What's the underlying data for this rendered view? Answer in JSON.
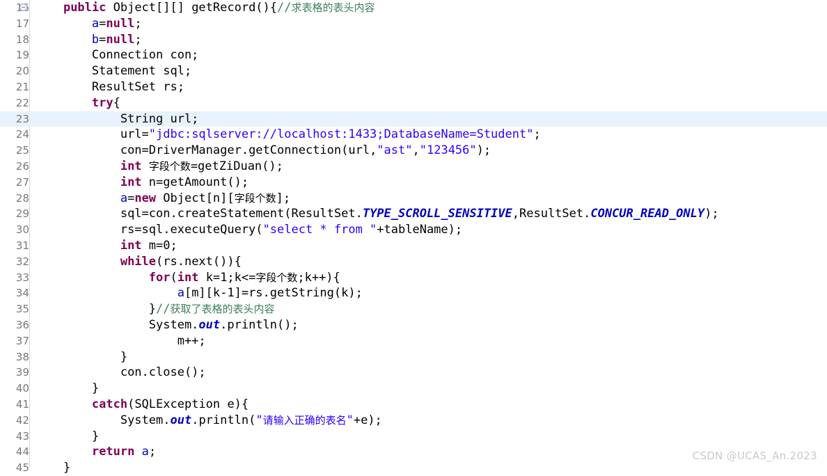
{
  "editor": {
    "first_line": 16,
    "current_line": 23,
    "folding_marker_line": 16,
    "colors": {
      "background": "#ffffff",
      "current_line_highlight": "#e8f2fc",
      "gutter_text": "#787878",
      "gutter_separator": "#d8d8d8",
      "keyword": "#7f0055",
      "string": "#2a00ff",
      "comment": "#3f7f5f",
      "field": "#0000c0",
      "static_constant": "#0000c0",
      "plain_text": "#000000",
      "watermark": "#c9c9c9"
    }
  },
  "watermark": "CSDN @UCAS_An.2023",
  "lines": [
    {
      "number": "16",
      "fold": true,
      "indent": 4,
      "tokens": [
        {
          "t": "public",
          "c": "kw"
        },
        {
          "t": " Object[][] getRecord(){",
          "c": "pln"
        },
        {
          "t": "//",
          "c": "cmt"
        },
        {
          "t": "求表格的表头内容",
          "c": "cmt cjk"
        }
      ]
    },
    {
      "number": "17",
      "fold": false,
      "indent": 8,
      "tokens": [
        {
          "t": "a",
          "c": "fld"
        },
        {
          "t": "=",
          "c": "pln"
        },
        {
          "t": "null",
          "c": "kw"
        },
        {
          "t": ";",
          "c": "pln"
        }
      ]
    },
    {
      "number": "18",
      "fold": false,
      "indent": 8,
      "tokens": [
        {
          "t": "b",
          "c": "fld"
        },
        {
          "t": "=",
          "c": "pln"
        },
        {
          "t": "null",
          "c": "kw"
        },
        {
          "t": ";",
          "c": "pln"
        }
      ]
    },
    {
      "number": "19",
      "fold": false,
      "indent": 8,
      "tokens": [
        {
          "t": "Connection con;",
          "c": "pln"
        }
      ]
    },
    {
      "number": "20",
      "fold": false,
      "indent": 8,
      "tokens": [
        {
          "t": "Statement sql;",
          "c": "pln"
        }
      ]
    },
    {
      "number": "21",
      "fold": false,
      "indent": 8,
      "tokens": [
        {
          "t": "ResultSet rs;",
          "c": "pln"
        }
      ]
    },
    {
      "number": "22",
      "fold": false,
      "indent": 8,
      "tokens": [
        {
          "t": "try",
          "c": "kw"
        },
        {
          "t": "{",
          "c": "pln"
        }
      ]
    },
    {
      "number": "23",
      "fold": false,
      "indent": 12,
      "tokens": [
        {
          "t": "String url;",
          "c": "pln"
        }
      ]
    },
    {
      "number": "24",
      "fold": false,
      "indent": 12,
      "tokens": [
        {
          "t": "url=",
          "c": "pln"
        },
        {
          "t": "\"jdbc:sqlserver://localhost:1433;DatabaseName=Student\"",
          "c": "str"
        },
        {
          "t": ";",
          "c": "pln"
        }
      ]
    },
    {
      "number": "25",
      "fold": false,
      "indent": 12,
      "tokens": [
        {
          "t": "con=DriverManager.",
          "c": "pln"
        },
        {
          "t": "getConnection",
          "c": "sm"
        },
        {
          "t": "(url,",
          "c": "pln"
        },
        {
          "t": "\"ast\"",
          "c": "str"
        },
        {
          "t": ",",
          "c": "pln"
        },
        {
          "t": "\"123456\"",
          "c": "str"
        },
        {
          "t": ");",
          "c": "pln"
        }
      ]
    },
    {
      "number": "26",
      "fold": false,
      "indent": 12,
      "tokens": [
        {
          "t": "int",
          "c": "kw"
        },
        {
          "t": " ",
          "c": "pln"
        },
        {
          "t": "字段个数",
          "c": "pln cjk"
        },
        {
          "t": "=getZiDuan();",
          "c": "pln"
        }
      ]
    },
    {
      "number": "27",
      "fold": false,
      "indent": 12,
      "tokens": [
        {
          "t": "int",
          "c": "kw"
        },
        {
          "t": " n=getAmount();",
          "c": "pln"
        }
      ]
    },
    {
      "number": "28",
      "fold": false,
      "indent": 12,
      "tokens": [
        {
          "t": "a",
          "c": "fld"
        },
        {
          "t": "=",
          "c": "pln"
        },
        {
          "t": "new",
          "c": "kw"
        },
        {
          "t": " Object[n][",
          "c": "pln"
        },
        {
          "t": "字段个数",
          "c": "pln cjk"
        },
        {
          "t": "];",
          "c": "pln"
        }
      ]
    },
    {
      "number": "29",
      "fold": false,
      "indent": 12,
      "tokens": [
        {
          "t": "sql=con.createStatement(ResultSet.",
          "c": "pln"
        },
        {
          "t": "TYPE_SCROLL_SENSITIVE",
          "c": "cst"
        },
        {
          "t": ",ResultSet.",
          "c": "pln"
        },
        {
          "t": "CONCUR_READ_ONLY",
          "c": "cst"
        },
        {
          "t": ");",
          "c": "pln"
        }
      ]
    },
    {
      "number": "30",
      "fold": false,
      "indent": 12,
      "tokens": [
        {
          "t": "rs=sql.executeQuery(",
          "c": "pln"
        },
        {
          "t": "\"select * from \"",
          "c": "str"
        },
        {
          "t": "+tableName);",
          "c": "pln"
        }
      ]
    },
    {
      "number": "31",
      "fold": false,
      "indent": 12,
      "tokens": [
        {
          "t": "int",
          "c": "kw"
        },
        {
          "t": " m=0;",
          "c": "pln"
        }
      ]
    },
    {
      "number": "32",
      "fold": false,
      "indent": 12,
      "tokens": [
        {
          "t": "while",
          "c": "kw"
        },
        {
          "t": "(rs.next()){",
          "c": "pln"
        }
      ]
    },
    {
      "number": "33",
      "fold": false,
      "indent": 16,
      "tokens": [
        {
          "t": "for",
          "c": "kw"
        },
        {
          "t": "(",
          "c": "pln"
        },
        {
          "t": "int",
          "c": "kw"
        },
        {
          "t": " k=1;k<=",
          "c": "pln"
        },
        {
          "t": "字段个数",
          "c": "pln cjk"
        },
        {
          "t": ";k++){",
          "c": "pln"
        }
      ]
    },
    {
      "number": "34",
      "fold": false,
      "indent": 20,
      "tokens": [
        {
          "t": "a",
          "c": "fld"
        },
        {
          "t": "[m][k-1]=rs.getString(k);",
          "c": "pln"
        }
      ]
    },
    {
      "number": "35",
      "fold": false,
      "indent": 16,
      "tokens": [
        {
          "t": "}",
          "c": "pln"
        },
        {
          "t": "//",
          "c": "cmt"
        },
        {
          "t": "获取了表格的表头内容",
          "c": "cmt cjk"
        }
      ]
    },
    {
      "number": "36",
      "fold": false,
      "indent": 16,
      "tokens": [
        {
          "t": "System.",
          "c": "pln"
        },
        {
          "t": "out",
          "c": "sfld"
        },
        {
          "t": ".println();",
          "c": "pln"
        }
      ]
    },
    {
      "number": "37",
      "fold": false,
      "indent": 20,
      "tokens": [
        {
          "t": "m++;",
          "c": "pln"
        }
      ]
    },
    {
      "number": "38",
      "fold": false,
      "indent": 12,
      "tokens": [
        {
          "t": "}",
          "c": "pln"
        }
      ]
    },
    {
      "number": "39",
      "fold": false,
      "indent": 12,
      "tokens": [
        {
          "t": "con.close();",
          "c": "pln"
        }
      ]
    },
    {
      "number": "40",
      "fold": false,
      "indent": 8,
      "tokens": [
        {
          "t": "}",
          "c": "pln"
        }
      ]
    },
    {
      "number": "41",
      "fold": false,
      "indent": 8,
      "tokens": [
        {
          "t": "catch",
          "c": "kw"
        },
        {
          "t": "(SQLException e){",
          "c": "pln"
        }
      ]
    },
    {
      "number": "42",
      "fold": false,
      "indent": 12,
      "tokens": [
        {
          "t": "System.",
          "c": "pln"
        },
        {
          "t": "out",
          "c": "sfld"
        },
        {
          "t": ".println(",
          "c": "pln"
        },
        {
          "t": "\"",
          "c": "str"
        },
        {
          "t": "请输入正确的表名",
          "c": "str cjk"
        },
        {
          "t": "\"",
          "c": "str"
        },
        {
          "t": "+e);",
          "c": "pln"
        }
      ]
    },
    {
      "number": "43",
      "fold": false,
      "indent": 8,
      "tokens": [
        {
          "t": "}",
          "c": "pln"
        }
      ]
    },
    {
      "number": "44",
      "fold": false,
      "indent": 8,
      "tokens": [
        {
          "t": "return",
          "c": "kw"
        },
        {
          "t": " ",
          "c": "pln"
        },
        {
          "t": "a",
          "c": "fld"
        },
        {
          "t": ";",
          "c": "pln"
        }
      ]
    },
    {
      "number": "45",
      "fold": false,
      "indent": 4,
      "tokens": [
        {
          "t": "}",
          "c": "pln"
        }
      ]
    }
  ]
}
